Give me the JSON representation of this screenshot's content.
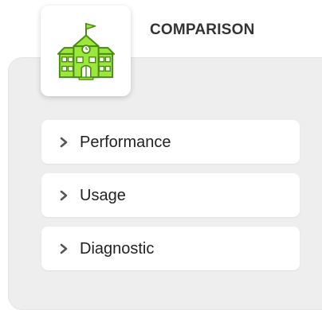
{
  "header": {
    "title": "COMPARISON",
    "icon": "school-icon",
    "icon_color": "#9BE83C"
  },
  "menu": {
    "items": [
      {
        "label": "Performance",
        "icon": "chevron-right-icon"
      },
      {
        "label": "Usage",
        "icon": "chevron-right-icon"
      },
      {
        "label": "Diagnostic",
        "icon": "chevron-right-icon"
      }
    ]
  },
  "colors": {
    "panel_background": "#EEEEEE",
    "card_background": "#FFFFFF",
    "chevron": "#555555"
  }
}
